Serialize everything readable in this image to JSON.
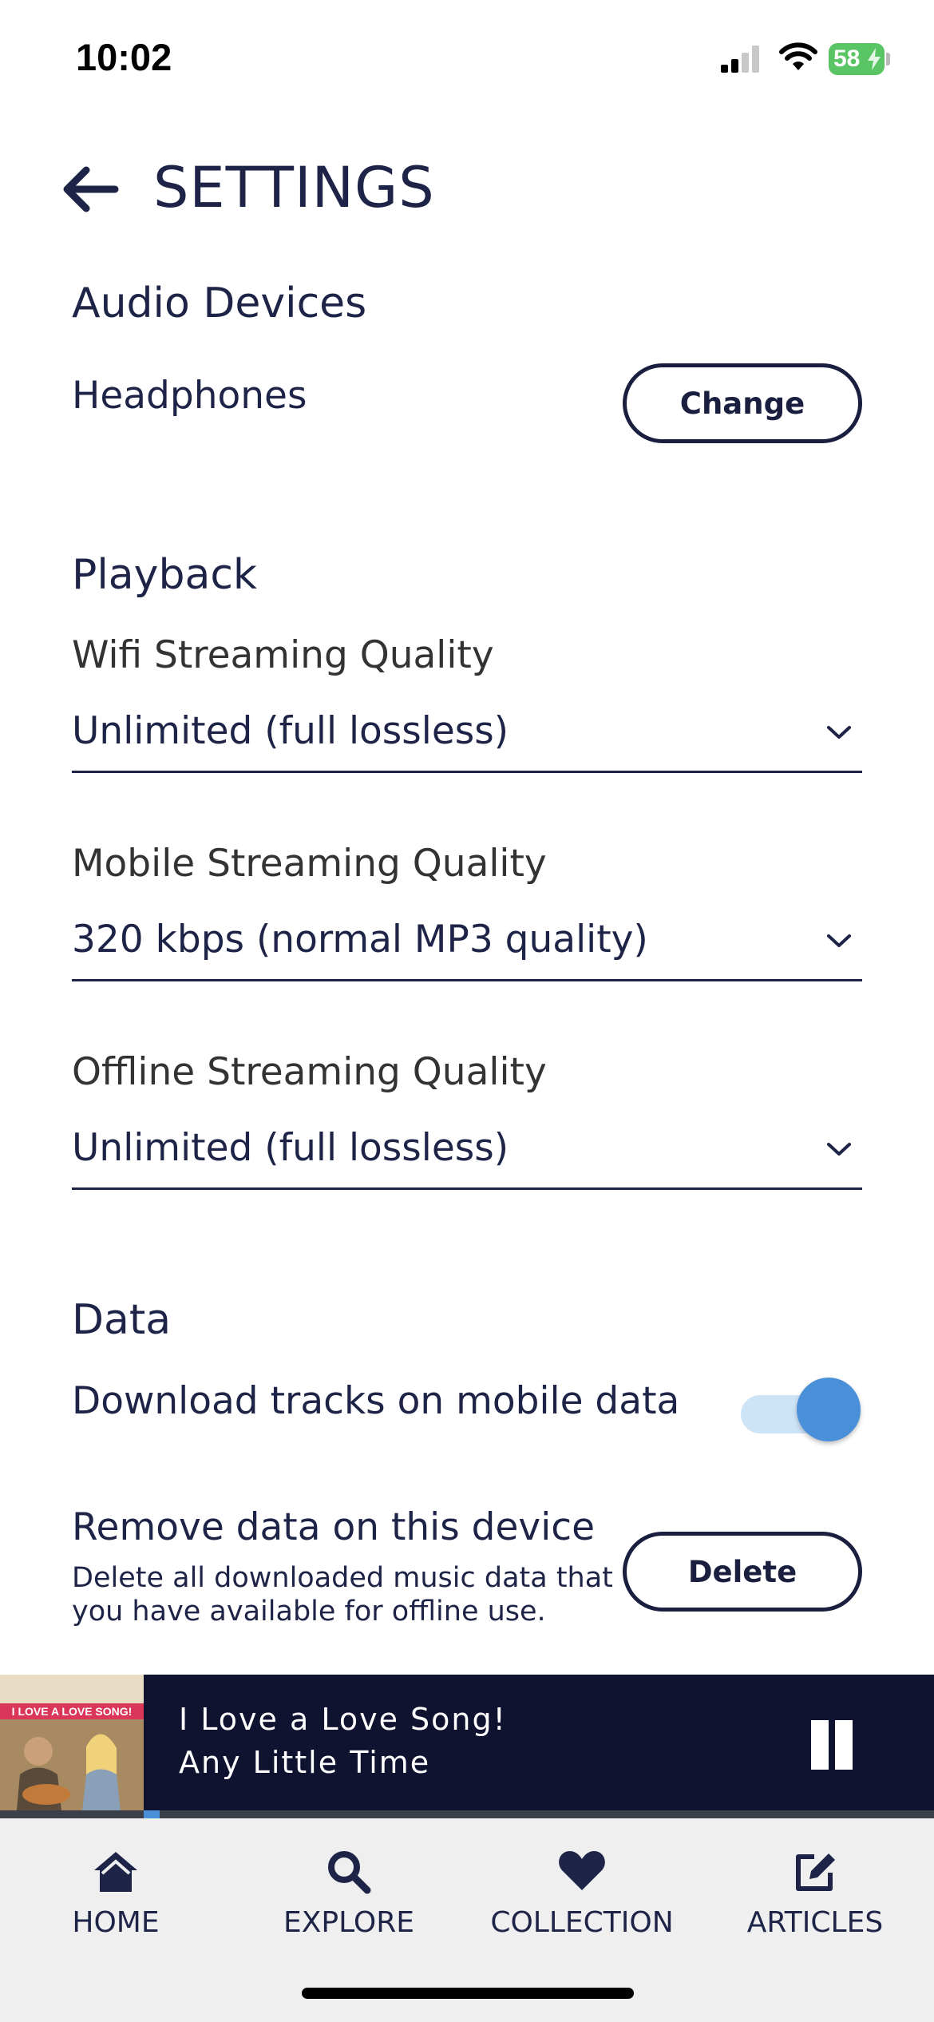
{
  "status_bar": {
    "time": "10:02",
    "battery": "58"
  },
  "header": {
    "title": "SETTINGS"
  },
  "audio_devices": {
    "section_title": "Audio Devices",
    "device_label": "Headphones",
    "change_label": "Change"
  },
  "playback": {
    "section_title": "Playback",
    "wifi": {
      "label": "Wifi Streaming Quality",
      "value": "Unlimited (full lossless)"
    },
    "mobile": {
      "label": "Mobile Streaming Quality",
      "value": "320 kbps (normal MP3 quality)"
    },
    "offline": {
      "label": "Offline Streaming Quality",
      "value": "Unlimited (full lossless)"
    }
  },
  "data": {
    "section_title": "Data",
    "download_label": "Download tracks on mobile data",
    "download_enabled": true,
    "remove_title": "Remove data on this device",
    "remove_description": "Delete all downloaded music data that you have available for offline use.",
    "delete_label": "Delete"
  },
  "now_playing": {
    "title": "I Love a Love Song!",
    "subtitle": "Any Little Time",
    "progress": 0.02,
    "album_art_text": "I LOVE A LOVE SONG!"
  },
  "tab_bar": {
    "items": [
      {
        "label": "HOME",
        "icon": "home-icon"
      },
      {
        "label": "EXPLORE",
        "icon": "search-icon"
      },
      {
        "label": "COLLECTION",
        "icon": "heart-icon"
      },
      {
        "label": "ARTICLES",
        "icon": "edit-icon"
      }
    ]
  },
  "colors": {
    "text": "#1e2447",
    "accent": "#4a90d9",
    "player_bg": "#0f1330",
    "tab_bg": "#efefef"
  }
}
